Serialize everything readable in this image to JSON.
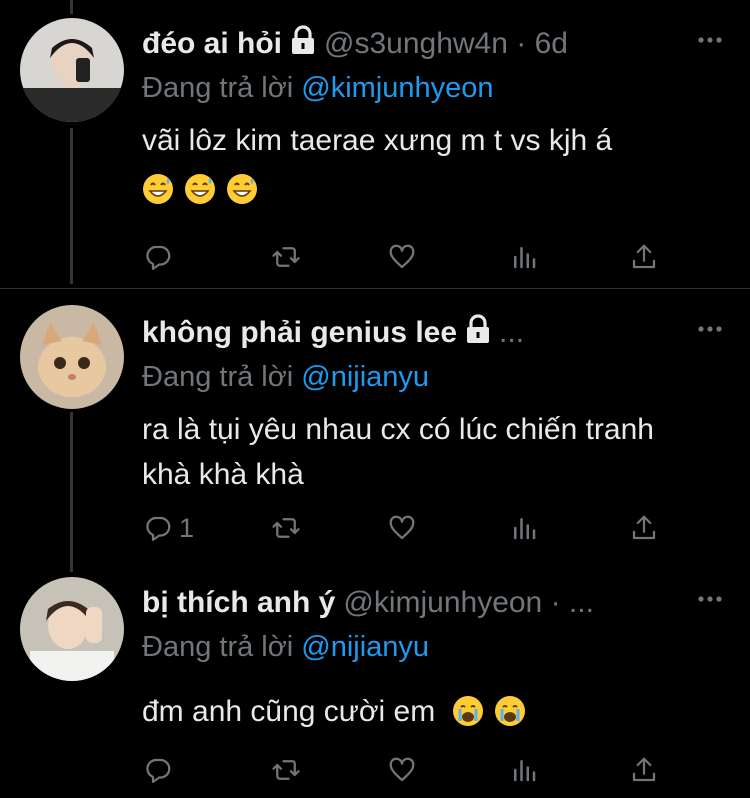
{
  "colors": {
    "background": "#000000",
    "text": "#e7e9ea",
    "secondary": "#71767b",
    "link": "#1d9bf0"
  },
  "tweets": [
    {
      "name": "đéo ai hỏi",
      "locked": true,
      "handle": "@s3unghw4n · 6d",
      "reply_label": "Đang trả lời",
      "reply_mention": "@kimjunhyeon",
      "text": "vãi lôz kim taerae xưng m t vs kjh á",
      "emojis": [
        "grinning-sweat-emoji",
        "grinning-sweat-emoji",
        "grinning-sweat-emoji"
      ],
      "reply_count": ""
    },
    {
      "name": "không phải genius lee",
      "locked": true,
      "handle": "...",
      "reply_label": "Đang trả lời",
      "reply_mention": "@nijianyu",
      "text": "ra là tụi yêu nhau cx có lúc chiến tranh khà khà khà",
      "emojis": [],
      "reply_count": "1"
    },
    {
      "name": "bị thích anh ý",
      "locked": false,
      "handle": "@kimjunhyeon · ...",
      "reply_label": "Đang trả lời",
      "reply_mention": "@nijianyu",
      "text": "đm anh cũng cười em",
      "emojis": [
        "crying-emoji",
        "crying-emoji"
      ],
      "reply_count": ""
    }
  ],
  "icons": [
    "reply-icon",
    "retweet-icon",
    "like-icon",
    "analytics-icon",
    "share-icon",
    "more-icon",
    "lock-icon"
  ]
}
